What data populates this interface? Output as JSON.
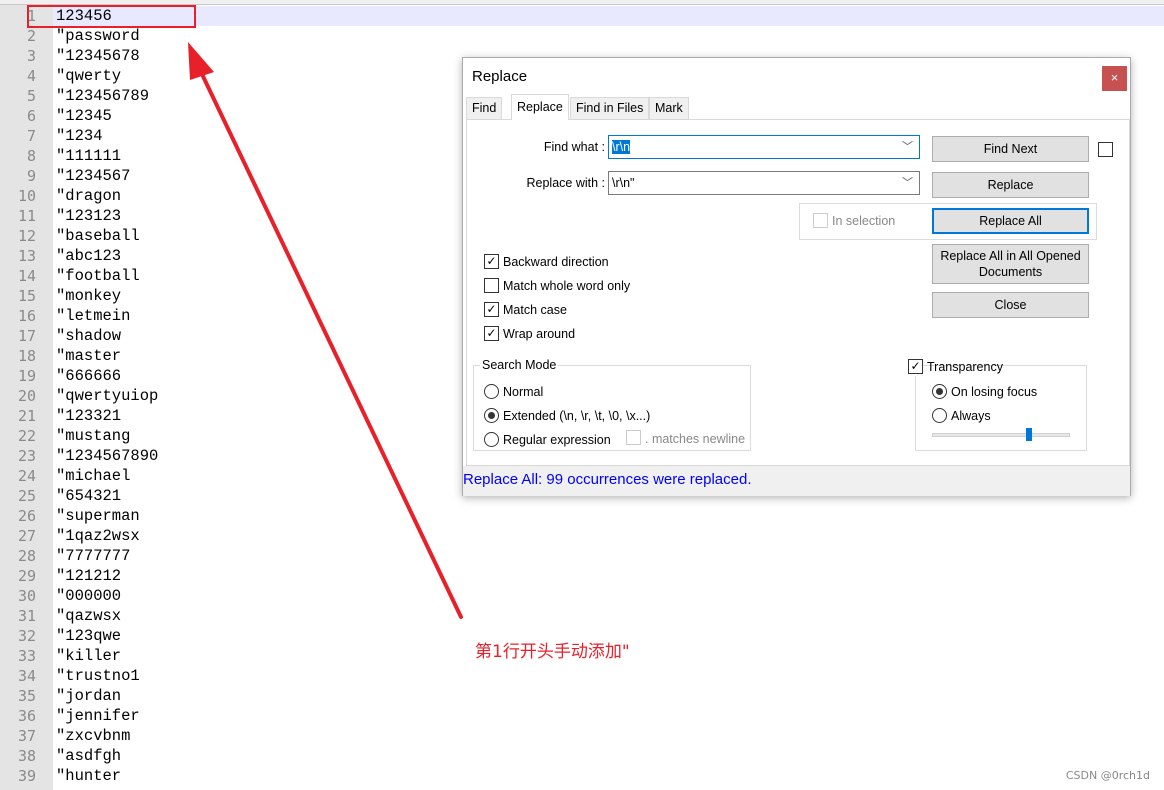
{
  "editor": {
    "lines": [
      "123456",
      "\"password",
      "\"12345678",
      "\"qwerty",
      "\"123456789",
      "\"12345",
      "\"1234",
      "\"111111",
      "\"1234567",
      "\"dragon",
      "\"123123",
      "\"baseball",
      "\"abc123",
      "\"football",
      "\"monkey",
      "\"letmein",
      "\"shadow",
      "\"master",
      "\"666666",
      "\"qwertyuiop",
      "\"123321",
      "\"mustang",
      "\"1234567890",
      "\"michael",
      "\"654321",
      "\"superman",
      "\"1qaz2wsx",
      "\"7777777",
      "\"121212",
      "\"000000",
      "\"qazwsx",
      "\"123qwe",
      "\"killer",
      "\"trustno1",
      "\"jordan",
      "\"jennifer",
      "\"zxcvbnm",
      "\"asdfgh",
      "\"hunter"
    ]
  },
  "annotation": {
    "text": "第1行开头手动添加\"",
    "color": "#e8202a"
  },
  "watermark": "CSDN @0rch1d",
  "dialog": {
    "title": "Replace",
    "close": "×",
    "tabs": [
      "Find",
      "Replace",
      "Find in Files",
      "Mark"
    ],
    "active_tab": "Replace",
    "find_label": "Find what :",
    "find_value": "\\r\\n",
    "replace_label": "Replace with :",
    "replace_value": "\\r\\n\"",
    "buttons": {
      "find_next": "Find Next",
      "replace": "Replace",
      "replace_all": "Replace All",
      "replace_all_opened": "Replace All in All Opened Documents",
      "close": "Close"
    },
    "in_selection": "In selection",
    "options": [
      {
        "label": "Backward direction",
        "checked": true
      },
      {
        "label": "Match whole word only",
        "checked": false
      },
      {
        "label": "Match case",
        "checked": true
      },
      {
        "label": "Wrap around",
        "checked": true
      }
    ],
    "search_mode": {
      "title": "Search Mode",
      "normal": "Normal",
      "extended": "Extended (\\n, \\r, \\t, \\0, \\x...)",
      "regex": "Regular expression",
      "matches_newline": ". matches newline",
      "selected": "Extended"
    },
    "transparency": {
      "label": "Transparency",
      "checked": true,
      "on_losing_focus": "On losing focus",
      "always": "Always",
      "selected": "On losing focus",
      "level": 0.7
    },
    "status": "Replace All: 99 occurrences were replaced.",
    "status_color": "#0000ff"
  }
}
